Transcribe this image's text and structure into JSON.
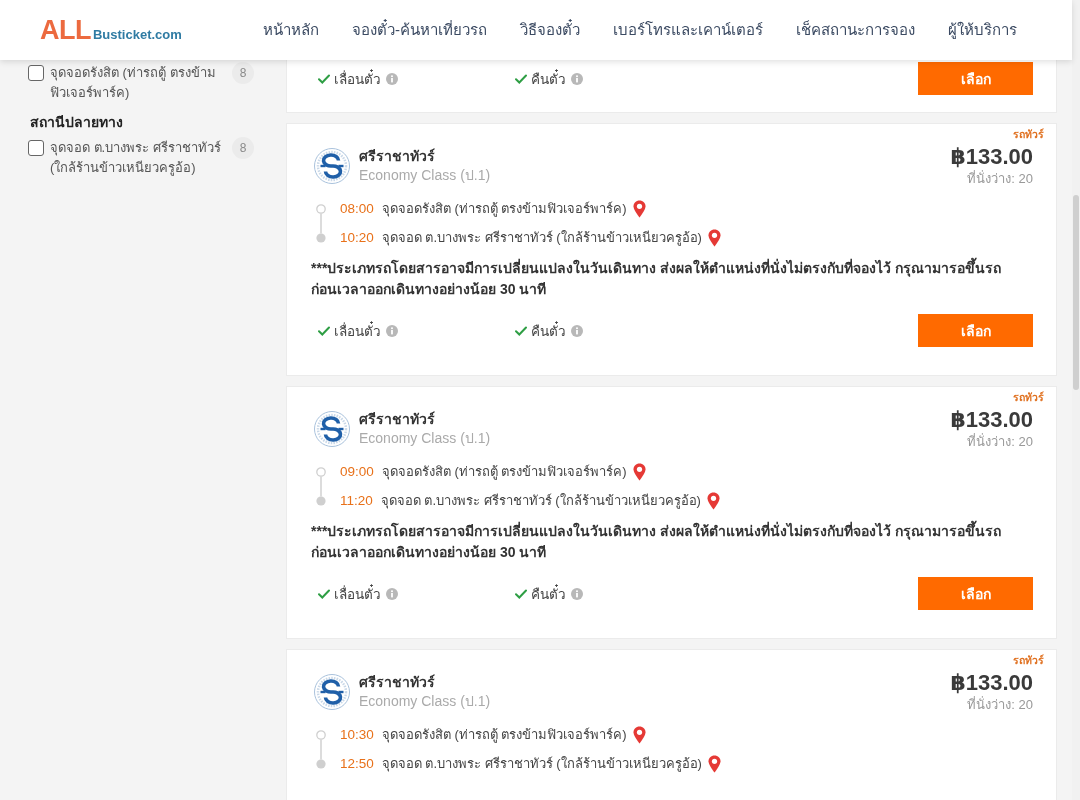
{
  "header": {
    "logo": {
      "primary": "ALL",
      "secondary": "Busticket.com"
    },
    "nav": [
      {
        "label": "หน้าหลัก"
      },
      {
        "label": "จองตั๋ว-ค้นหาเที่ยวรถ"
      },
      {
        "label": "วิธีจองตั๋ว"
      },
      {
        "label": "เบอร์โทรและเคาน์เตอร์"
      },
      {
        "label": "เช็คสถานะการจอง"
      },
      {
        "label": "ผู้ให้บริการ"
      }
    ]
  },
  "sidebar": {
    "groups": [
      {
        "items": [
          {
            "label": "จุดจอดรังสิต (ท่ารถตู้ ตรงข้ามฟิวเจอร์พาร์ค)",
            "count": "8",
            "checked": false
          }
        ]
      },
      {
        "title": "สถานีปลายทาง",
        "items": [
          {
            "label": "จุดจอด ต.บางพระ ศรีราชาทัวร์ (ใกล้ร้านข้าวเหนียวครูอ้อ)",
            "count": "8",
            "checked": false
          }
        ]
      }
    ]
  },
  "trips": [
    {
      "features": [
        {
          "label": "เลื่อนตั๋ว",
          "available": true
        },
        {
          "label": "คืนตั๋ว",
          "available": true
        }
      ],
      "select_button": "เลือก"
    },
    {
      "type_label": "รถทัวร์",
      "operator": "ศรีราชาทัวร์",
      "class": "Economy Class (ป.1)",
      "price": "฿133.00",
      "seats": "ที่นั่งว่าง: 20",
      "stops": [
        {
          "time": "08:00",
          "name": "จุดจอดรังสิต (ท่ารถตู้ ตรงข้ามฟิวเจอร์พาร์ค)"
        },
        {
          "time": "10:20",
          "name": "จุดจอด ต.บางพระ ศรีราชาทัวร์ (ใกล้ร้านข้าวเหนียวครูอ้อ)"
        }
      ],
      "note": "***ประเภทรถโดยสารอาจมีการเปลี่ยนแปลงในวันเดินทาง ส่งผลให้ตำแหน่งที่นั่งไม่ตรงกับที่จองไว้ กรุณามารอขึ้นรถก่อนเวลาออกเดินทางอย่างน้อย 30 นาที",
      "features": [
        {
          "label": "เลื่อนตั๋ว",
          "available": true
        },
        {
          "label": "คืนตั๋ว",
          "available": true
        }
      ],
      "select_button": "เลือก"
    },
    {
      "type_label": "รถทัวร์",
      "operator": "ศรีราชาทัวร์",
      "class": "Economy Class (ป.1)",
      "price": "฿133.00",
      "seats": "ที่นั่งว่าง: 20",
      "stops": [
        {
          "time": "09:00",
          "name": "จุดจอดรังสิต (ท่ารถตู้ ตรงข้ามฟิวเจอร์พาร์ค)"
        },
        {
          "time": "11:20",
          "name": "จุดจอด ต.บางพระ ศรีราชาทัวร์ (ใกล้ร้านข้าวเหนียวครูอ้อ)"
        }
      ],
      "note": "***ประเภทรถโดยสารอาจมีการเปลี่ยนแปลงในวันเดินทาง ส่งผลให้ตำแหน่งที่นั่งไม่ตรงกับที่จองไว้ กรุณามารอขึ้นรถก่อนเวลาออกเดินทางอย่างน้อย 30 นาที",
      "features": [
        {
          "label": "เลื่อนตั๋ว",
          "available": true
        },
        {
          "label": "คืนตั๋ว",
          "available": true
        }
      ],
      "select_button": "เลือก"
    },
    {
      "type_label": "รถทัวร์",
      "operator": "ศรีราชาทัวร์",
      "class": "Economy Class (ป.1)",
      "price": "฿133.00",
      "seats": "ที่นั่งว่าง: 20",
      "stops": [
        {
          "time": "10:30",
          "name": "จุดจอดรังสิต (ท่ารถตู้ ตรงข้ามฟิวเจอร์พาร์ค)"
        },
        {
          "time": "12:50",
          "name": "จุดจอด ต.บางพระ ศรีราชาทัวร์ (ใกล้ร้านข้าวเหนียวครูอ้อ)"
        }
      ]
    }
  ]
}
